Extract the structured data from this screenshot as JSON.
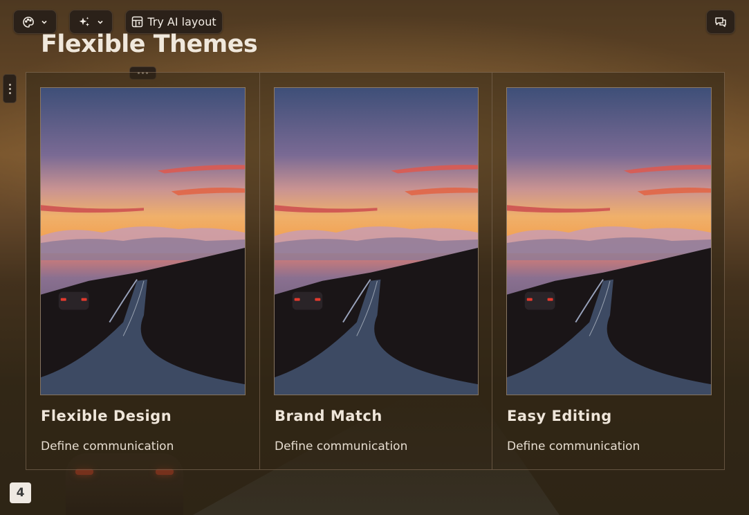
{
  "toolbar": {
    "theme_icon": "palette-icon",
    "ai_icon": "sparkle-icon",
    "layout_icon": "layout-icon",
    "layout_label": "Try AI layout",
    "comment_icon": "comment-icon"
  },
  "slide": {
    "title": "Flexible Themes",
    "cards": [
      {
        "title": "Flexible Design",
        "description": "Define communication",
        "image": "sunset-road-car-image"
      },
      {
        "title": "Brand Match",
        "description": "Define communication",
        "image": "sunset-road-car-image"
      },
      {
        "title": "Easy Editing",
        "description": "Define communication",
        "image": "sunset-road-car-image"
      }
    ]
  },
  "page_number": "4",
  "colors": {
    "toolbar_bg": "#2b2119",
    "title_text": "#f0e8dc",
    "card_bg": "#32261a"
  }
}
